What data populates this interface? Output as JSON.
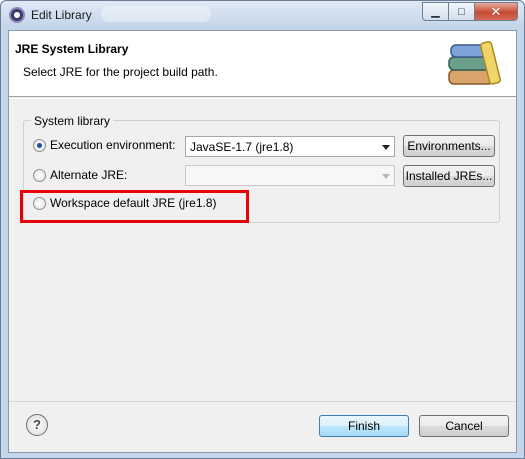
{
  "window": {
    "title": "Edit Library"
  },
  "banner": {
    "title": "JRE System Library",
    "message": "Select JRE for the project build path."
  },
  "group": {
    "label": "System library",
    "options": [
      {
        "label": "Execution environment:",
        "selected": true
      },
      {
        "label": "Alternate JRE:",
        "selected": false
      },
      {
        "label": "Workspace default JRE (jre1.8)",
        "selected": false
      }
    ],
    "execution_env_value": "JavaSE-1.7 (jre1.8)",
    "alternate_jre_value": "",
    "environments_button": "Environments...",
    "installed_jres_button": "Installed JREs..."
  },
  "footer": {
    "finish_button": "Finish",
    "cancel_button": "Cancel",
    "help_glyph": "?"
  },
  "colors": {
    "highlight": "#e8000c",
    "default_button": "#3c7fb1"
  },
  "icons": [
    "eclipse-app-icon",
    "minimize-icon",
    "maximize-icon",
    "close-icon",
    "library-books-icon",
    "help-icon"
  ]
}
